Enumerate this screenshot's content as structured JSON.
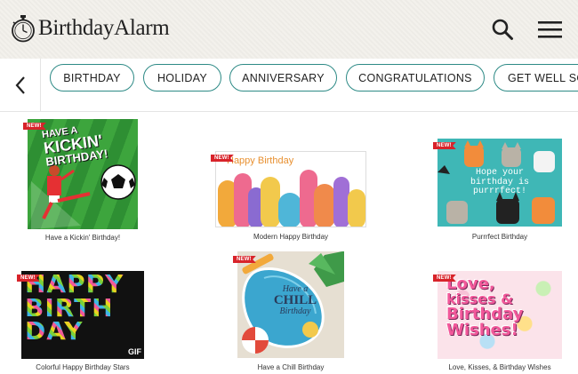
{
  "header": {
    "brand": "BirthdayAlarm",
    "search_icon": "search-icon",
    "menu_icon": "hamburger-menu-icon"
  },
  "categories": {
    "back_icon": "chevron-left-icon",
    "items": [
      "BIRTHDAY",
      "HOLIDAY",
      "ANNIVERSARY",
      "CONGRATULATIONS",
      "GET WELL SOON"
    ]
  },
  "cards": [
    {
      "title": "Have a Kickin' Birthday!",
      "badge": "NEW!",
      "art": {
        "line1": "HAVE A",
        "line2": "KICKIN'",
        "line3": "BIRTHDAY!"
      }
    },
    {
      "title": "Modern Happy Birthday",
      "badge": "NEW!",
      "art": {
        "line1": "Happy Birthday"
      }
    },
    {
      "title": "Purrrfect Birthday",
      "badge": "NEW!",
      "art": {
        "line1": "Hope your",
        "line2": "birthday is",
        "line3": "purrrfect!"
      }
    },
    {
      "title": "Colorful Happy Birthday Stars",
      "badge": "NEW!",
      "art": {
        "line1": "HAPPY",
        "line2": "BIRTH",
        "line3": "DAY",
        "tag": "GIF"
      }
    },
    {
      "title": "Have a Chill Birthday",
      "badge": "NEW!",
      "art": {
        "line1": "Have a",
        "line2": "CHILL",
        "line3": "Birthday"
      }
    },
    {
      "title": "Love, Kisses, & Birthday Wishes",
      "badge": "NEW!",
      "art": {
        "line1": "Love,",
        "line2": "kisses &",
        "line3": "Birthday",
        "line4": "Wishes!"
      }
    }
  ]
}
